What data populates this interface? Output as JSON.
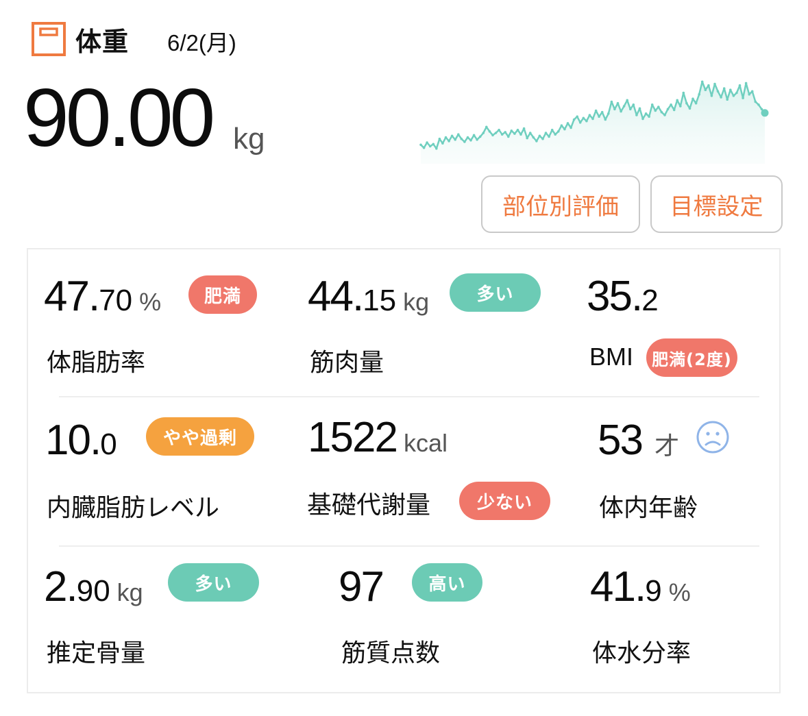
{
  "header": {
    "title": "体重",
    "date": "6/2(月)",
    "weight_value": "90.00",
    "weight_unit": "kg",
    "icon": "scale-icon",
    "accent_color": "#ef7a40"
  },
  "trend": {
    "icon": "weight-trend-sparkline",
    "line_color": "#6fcfbf",
    "values": [
      50,
      46,
      53,
      48,
      51,
      45,
      58,
      52,
      60,
      55,
      62,
      57,
      64,
      58,
      54,
      60,
      56,
      63,
      57,
      61,
      66,
      74,
      68,
      63,
      66,
      70,
      64,
      67,
      61,
      69,
      65,
      70,
      64,
      72,
      59,
      66,
      60,
      55,
      62,
      58,
      66,
      61,
      70,
      64,
      68,
      76,
      71,
      79,
      73,
      84,
      88,
      80,
      86,
      82,
      90,
      85,
      96,
      88,
      94,
      84,
      92,
      108,
      98,
      106,
      95,
      102,
      110,
      98,
      104,
      90,
      99,
      85,
      92,
      88,
      104,
      96,
      101,
      94,
      90,
      98,
      104,
      97,
      110,
      102,
      120,
      106,
      99,
      112,
      106,
      118,
      135,
      124,
      130,
      116,
      132,
      122,
      114,
      126,
      111,
      124,
      116,
      120,
      130,
      113,
      133,
      118,
      122,
      108,
      104,
      98,
      93
    ],
    "ylim": [
      30,
      150
    ]
  },
  "buttons": {
    "evaluation_label": "部位別評価",
    "goal_label": "目標設定"
  },
  "metrics": {
    "body_fat": {
      "int": "47.",
      "frac": "70",
      "unit": "%",
      "label": "体脂肪率",
      "badge": "肥満"
    },
    "muscle": {
      "int": "44.",
      "frac": "15",
      "unit": "kg",
      "label": "筋肉量",
      "badge": "多い"
    },
    "bmi": {
      "int": "35.",
      "frac": "2",
      "label": "BMI",
      "badge": "肥満(2度)"
    },
    "visceral_fat": {
      "int": "10.",
      "frac": "0",
      "label": "内臓脂肪レベル",
      "badge": "やや過剰"
    },
    "bmr": {
      "int": "1522",
      "unit": "kcal",
      "label": "基礎代謝量",
      "badge": "少ない"
    },
    "body_age": {
      "int": "53",
      "unit": "才",
      "label": "体内年齢",
      "icon": "sad-face-icon"
    },
    "bone": {
      "int": "2.",
      "frac": "90",
      "unit": "kg",
      "label": "推定骨量",
      "badge": "多い"
    },
    "muscle_quality": {
      "int": "97",
      "label": "筋質点数",
      "badge": "高い"
    },
    "body_water": {
      "int": "41.",
      "frac": "9",
      "unit": "%",
      "label": "体水分率"
    }
  },
  "colors": {
    "badge_red": "#f0776a",
    "badge_teal": "#6ccbb5",
    "badge_orange": "#f5a23f",
    "face_blue": "#8fb4e8"
  }
}
